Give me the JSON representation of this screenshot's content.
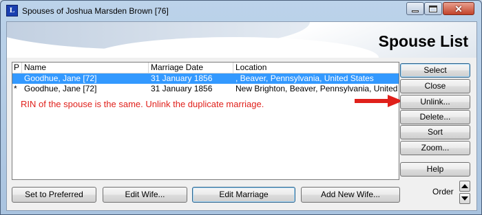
{
  "window": {
    "app_icon_letter": "L",
    "title": "Spouses of Joshua Marsden Brown [76]"
  },
  "heading": "Spouse List",
  "list": {
    "columns": [
      "P",
      "Name",
      "Marriage Date",
      "Location"
    ],
    "rows": [
      {
        "p": "",
        "name": "Goodhue, Jane [72]",
        "date": "31 January 1856",
        "location": ", Beaver, Pennsylvania, United States",
        "selected": true
      },
      {
        "p": "*",
        "name": "Goodhue, Jane [72]",
        "date": "31 January 1856",
        "location": "New Brighton, Beaver, Pennsylvania, United",
        "selected": false
      }
    ]
  },
  "annotation": "RIN of the spouse is the same. Unlink the duplicate marriage.",
  "side_buttons": {
    "select": "Select",
    "close": "Close",
    "unlink": "Unlink...",
    "delete": "Delete...",
    "sort": "Sort",
    "zoom": "Zoom...",
    "help": "Help"
  },
  "bottom_buttons": {
    "set_preferred": "Set to Preferred",
    "edit_wife": "Edit Wife...",
    "edit_marriage": "Edit Marriage",
    "add_new_wife": "Add New Wife..."
  },
  "order_label": "Order",
  "colors": {
    "selection": "#3399ff",
    "annotation": "#e0201b"
  }
}
